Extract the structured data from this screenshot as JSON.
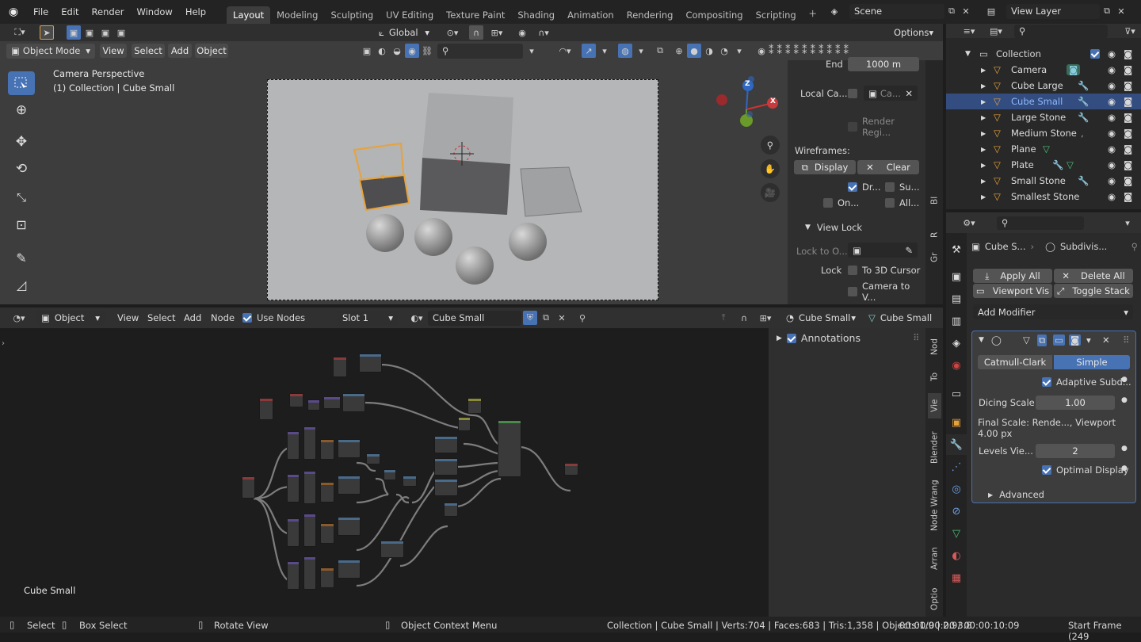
{
  "topbar": {
    "menus": [
      "File",
      "Edit",
      "Render",
      "Window",
      "Help"
    ],
    "workspaces": [
      "Layout",
      "Modeling",
      "Sculpting",
      "UV Editing",
      "Texture Paint",
      "Shading",
      "Animation",
      "Rendering",
      "Compositing",
      "Scripting"
    ],
    "active_workspace": "Layout",
    "scene": "Scene",
    "view_layer": "View Layer"
  },
  "viewport": {
    "transform_orientation": "Global",
    "options_label": "Options",
    "mode": "Object Mode",
    "menus": [
      "View",
      "Select",
      "Add",
      "Object"
    ],
    "overlay_title": "Camera Perspective",
    "overlay_subtitle": "(1) Collection | Cube Small",
    "gizmo": {
      "x": "X",
      "y": "Y",
      "z": "Z"
    }
  },
  "npanel": {
    "end_label": "End",
    "end_value": "1000 m",
    "local_camera_label": "Local Ca...",
    "local_camera_value": "Ca...",
    "render_region_label": "Render Regi...",
    "wireframes_label": "Wireframes:",
    "display_label": "Display",
    "clear_label": "Clear",
    "dr_label": "Dr...",
    "su_label": "Su...",
    "on_label": "On...",
    "all_label": "All...",
    "view_lock_label": "View Lock",
    "lock_to_label": "Lock to O...",
    "lock_label": "Lock",
    "to_cursor_label": "To 3D Cursor",
    "camera_to_label": "Camera to V...",
    "tabs": [
      "Bl",
      "R",
      "Gr"
    ]
  },
  "outliner": {
    "collection": "Collection",
    "items": [
      {
        "name": "Camera",
        "extra": "camera-data"
      },
      {
        "name": "Cube Large",
        "extra": "wrench"
      },
      {
        "name": "Cube Small",
        "extra": "wrench",
        "selected": true
      },
      {
        "name": "Large Stone",
        "extra": "wrench"
      },
      {
        "name": "Medium Stone",
        "extra": "dot"
      },
      {
        "name": "Plane",
        "extra": "mesh"
      },
      {
        "name": "Plate",
        "extra": "wrench-mesh"
      },
      {
        "name": "Small Stone",
        "extra": "wrench"
      },
      {
        "name": "Smallest Stone",
        "extra": "none"
      }
    ]
  },
  "properties": {
    "object_name": "Cube S...",
    "modifier_crumb": "Subdivis...",
    "apply_all": "Apply All",
    "delete_all": "Delete All",
    "viewport_vis": "Viewport Vis",
    "toggle_stack": "Toggle Stack",
    "add_modifier": "Add Modifier",
    "catmull": "Catmull-Clark",
    "simple": "Simple",
    "adaptive": "Adaptive Subd...",
    "dicing_label": "Dicing Scale",
    "dicing_value": "1.00",
    "final_scale": "Final Scale: Rende..., Viewport 4.00 px",
    "levels_label": "Levels Vie...",
    "levels_value": "2",
    "optimal": "Optimal Display",
    "advanced": "Advanced"
  },
  "node_editor": {
    "editor_type": "Object",
    "menus": [
      "View",
      "Select",
      "Add",
      "Node"
    ],
    "use_nodes": "Use Nodes",
    "slot": "Slot 1",
    "material": "Cube Small",
    "object_crumb": "Cube Small",
    "mesh_crumb": "Cube Small",
    "sidebar_annotations": "Annotations",
    "sidebar_tabs": [
      "Nod",
      "To",
      "Vie",
      "Blender",
      "Node Wrang",
      "Arran",
      "Optio"
    ],
    "corner_label": "Cube Small"
  },
  "statusbar": {
    "select": "Select",
    "box_select": "Box Select",
    "rotate_view": "Rotate View",
    "context_menu": "Object Context Menu",
    "stats": "Collection | Cube Small | Verts:704 | Faces:683 | Tris:1,358 | Objects:1/9 | 2.93.8",
    "timecode": "00:00:00:00 / 00:00:10:09",
    "start_frame": "Start Frame (249"
  },
  "colors": {
    "accent": "#4772b3",
    "selection_orange": "#e8a23a",
    "selected_row": "#334d80"
  }
}
